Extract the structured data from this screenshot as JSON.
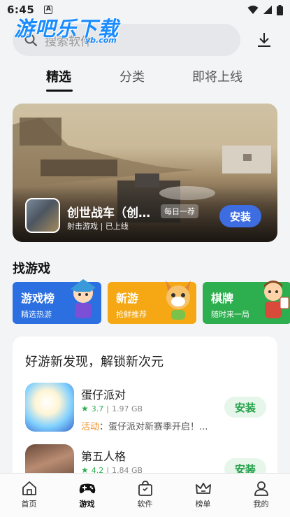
{
  "status_bar": {
    "time": "6:45",
    "notif_letter": "A"
  },
  "watermark": {
    "text": "游吧乐下载",
    "sub": "yb.com"
  },
  "search": {
    "placeholder": "搜索软件"
  },
  "tabs": [
    {
      "label": "精选",
      "active": true
    },
    {
      "label": "分类",
      "active": false
    },
    {
      "label": "即将上线",
      "active": false
    }
  ],
  "banner": {
    "title": "创世战车（创世战车）",
    "badge": "每日一荐",
    "subtitle": "射击游戏 | 已上线",
    "install_label": "安装"
  },
  "find_games": {
    "title": "找游戏",
    "cards": [
      {
        "title": "游戏榜",
        "subtitle": "精选热游",
        "color": "#2b6fe0"
      },
      {
        "title": "新游",
        "subtitle": "抢鲜推荐",
        "color": "#f5a814"
      },
      {
        "title": "棋牌",
        "subtitle": "随时来一局",
        "color": "#2eaf4f"
      }
    ]
  },
  "discover": {
    "title": "好游新发现，解锁新次元",
    "games": [
      {
        "name": "蛋仔派对",
        "rating": "3.7",
        "size": "1.97 GB",
        "activity_tag": "活动",
        "activity": "：蛋仔派对新赛季开启！...",
        "install_label": "安装"
      },
      {
        "name": "第五人格",
        "rating": "4.2",
        "size": "1.84 GB",
        "install_label": "安装"
      }
    ]
  },
  "bottom_nav": [
    {
      "label": "首页",
      "icon": "home-icon",
      "active": false
    },
    {
      "label": "游戏",
      "icon": "gamepad-icon",
      "active": true
    },
    {
      "label": "软件",
      "icon": "bag-icon",
      "active": false
    },
    {
      "label": "榜单",
      "icon": "crown-icon",
      "active": false
    },
    {
      "label": "我的",
      "icon": "person-icon",
      "active": false
    }
  ],
  "colors": {
    "accent": "#3d6de0",
    "install_green": "#23a04a",
    "activity_orange": "#f08a1c",
    "watermark_blue": "#1a8cff"
  }
}
